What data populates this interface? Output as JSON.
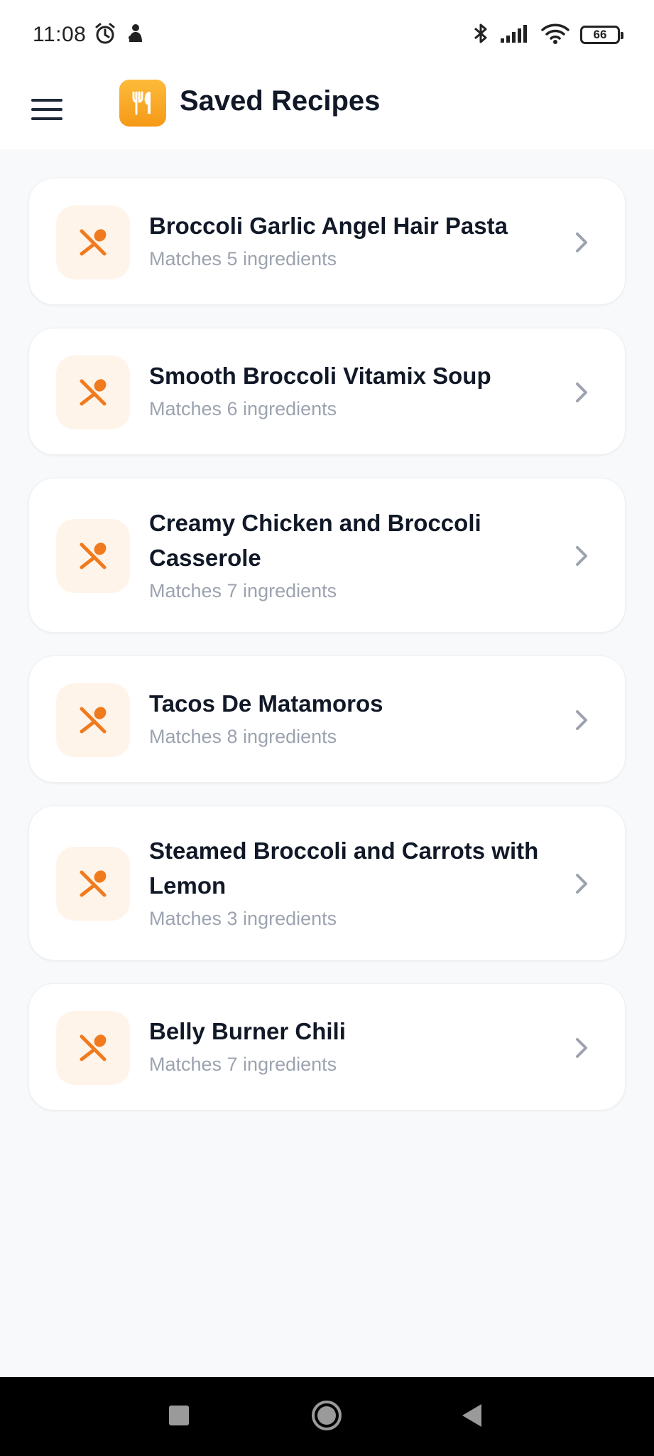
{
  "status": {
    "time": "11:08",
    "battery": "66",
    "icons": [
      "alarm-icon",
      "notification-icon",
      "bluetooth-icon",
      "signal-icon",
      "wifi-icon",
      "battery-icon"
    ]
  },
  "app_bar": {
    "title": "Saved Recipes",
    "menu_icon": "hamburger-menu-icon",
    "logo_icon": "utensils-icon",
    "logo_color": "#f7a421"
  },
  "recipes": [
    {
      "title": "Broccoli Garlic Angel Hair Pasta",
      "subtitle": "Matches 5 ingredients"
    },
    {
      "title": "Smooth Broccoli Vitamix Soup",
      "subtitle": "Matches 6 ingredients"
    },
    {
      "title": "Creamy Chicken and Broccoli Casserole",
      "subtitle": "Matches 7 ingredients"
    },
    {
      "title": "Tacos De Matamoros",
      "subtitle": "Matches 8 ingredients"
    },
    {
      "title": "Steamed Broccoli and Carrots with Lemon",
      "subtitle": "Matches 3 ingredients"
    },
    {
      "title": "Belly Burner Chili",
      "subtitle": "Matches 7 ingredients"
    }
  ],
  "colors": {
    "accent": "#f07a1e",
    "icon_bg": "#fff4ea",
    "title_text": "#111827",
    "subtitle_text": "#9ca3af",
    "page_bg": "#f8f9fb"
  },
  "nav": [
    "recents-icon",
    "home-icon",
    "back-icon"
  ]
}
